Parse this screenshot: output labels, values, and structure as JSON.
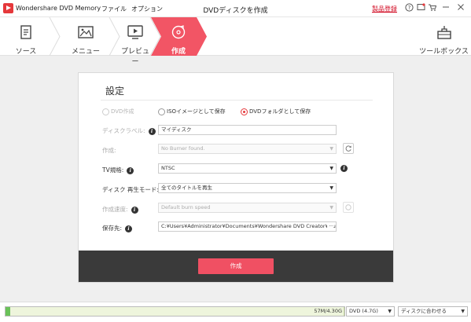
{
  "app": {
    "name": "Wondershare DVD Memory",
    "menu": [
      "ファイル",
      "オプション"
    ],
    "window_title": "DVDディスクを作成",
    "register_label": "製品登録"
  },
  "steps": [
    {
      "label": "ソース",
      "icon": "document-icon",
      "active": false
    },
    {
      "label": "メニュー",
      "icon": "image-icon",
      "active": false
    },
    {
      "label": "プレビュー",
      "icon": "play-screen-icon",
      "active": false
    },
    {
      "label": "作成",
      "icon": "disc-icon",
      "active": true
    }
  ],
  "toolbox_label": "ツールボックス",
  "dialog": {
    "title": "設定",
    "output_options": [
      {
        "label": "DVD作成",
        "state": "disabled"
      },
      {
        "label": "ISOイメージとして保存",
        "state": "unchecked"
      },
      {
        "label": "DVDフォルダとして保存",
        "state": "checked"
      }
    ],
    "disc_label": {
      "label": "ディスクラベル:",
      "value": "マイディスク"
    },
    "burner": {
      "label": "作成:",
      "value": "No Burner found."
    },
    "tv_standard": {
      "label": "TV規格:",
      "value": "NTSC"
    },
    "disc_playback_mode": {
      "label": "ディスク 再生モード:",
      "value": "全てのタイトルを再生"
    },
    "burn_speed": {
      "label": "作成速度:",
      "value": "Default burn speed"
    },
    "save_path": {
      "label": "保存先:",
      "value": "C:¥Users¥Administrator¥Documents¥Wondershare DVD Creator¥Output"
    },
    "create_button": "作成"
  },
  "status": {
    "capacity_text": "57M/4.30G",
    "capacity_fraction": 0.013,
    "disc_type": "DVD (4.7G)",
    "fit_mode": "ディスクに合わせる"
  },
  "colors": {
    "accent": "#f25565",
    "brand_red": "#e5383b",
    "footer_dark": "#3a3a3a"
  }
}
